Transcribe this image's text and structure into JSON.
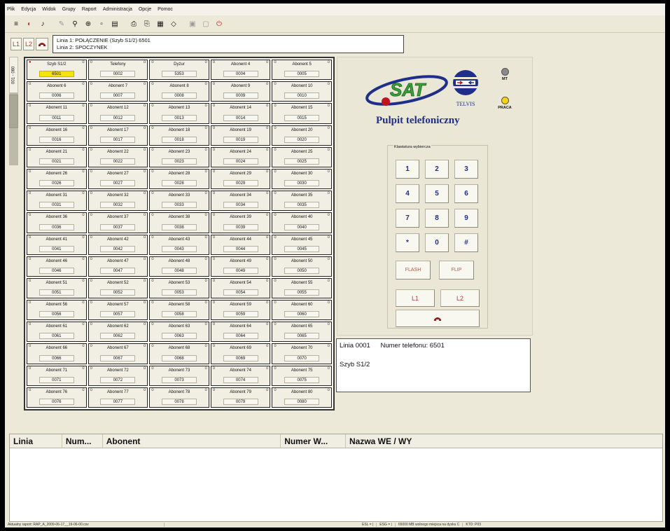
{
  "menu": [
    "Plik",
    "Edycja",
    "Widok",
    "Grupy",
    "Raport",
    "Administracja",
    "Opcje",
    "Pomoc"
  ],
  "toolbar": {
    "buttons": [
      {
        "icon": "list-icon",
        "glyph": "≡"
      },
      {
        "icon": "color-icon",
        "glyph": "◐"
      },
      {
        "icon": "sound-icon",
        "glyph": "♪"
      },
      {
        "icon": "edit-icon",
        "glyph": "✎"
      },
      {
        "icon": "binoculars-icon",
        "glyph": "⚲"
      },
      {
        "icon": "target-icon",
        "glyph": "⊕"
      },
      {
        "icon": "alarm-icon",
        "glyph": "▫"
      },
      {
        "icon": "document-icon",
        "glyph": "▤"
      },
      {
        "icon": "print-icon",
        "glyph": "⎙"
      },
      {
        "icon": "print-preview-icon",
        "glyph": "⎘"
      },
      {
        "icon": "calendar-icon",
        "glyph": "▦"
      },
      {
        "icon": "tag-icon",
        "glyph": "◇"
      },
      {
        "icon": "lock-icon",
        "glyph": "▣"
      },
      {
        "icon": "unlock-icon",
        "glyph": "▢"
      },
      {
        "icon": "power-icon",
        "glyph": "⏻"
      }
    ]
  },
  "linebar": {
    "l1": "L1",
    "l2": "L2",
    "line1": "Linia 1: POŁĄCZENIE (Szyb S1/2) 6501",
    "line2": "Linia 2: SPOCZYNEK"
  },
  "sidetab": "001 - 080",
  "subscribers": [
    {
      "name": "Szyb S1/2",
      "num": "6501",
      "active": true
    },
    {
      "name": "Telefony",
      "num": "0002"
    },
    {
      "name": "Dyżur",
      "num": "5353"
    },
    {
      "name": "Abonent 4",
      "num": "0004"
    },
    {
      "name": "Abonent 5",
      "num": "0005"
    },
    {
      "name": "Abonent 6",
      "num": "0006"
    },
    {
      "name": "Abonent 7",
      "num": "0007"
    },
    {
      "name": "Abonent 8",
      "num": "0008"
    },
    {
      "name": "Abonent 9",
      "num": "0009"
    },
    {
      "name": "Abonent 10",
      "num": "0010"
    },
    {
      "name": "Abonent 11",
      "num": "0011"
    },
    {
      "name": "Abonent 12",
      "num": "0012"
    },
    {
      "name": "Abonent 13",
      "num": "0013"
    },
    {
      "name": "Abonent 14",
      "num": "0014"
    },
    {
      "name": "Abonent 15",
      "num": "0015"
    },
    {
      "name": "Abonent 16",
      "num": "0016"
    },
    {
      "name": "Abonent 17",
      "num": "0017"
    },
    {
      "name": "Abonent 18",
      "num": "0018"
    },
    {
      "name": "Abonent 19",
      "num": "0019"
    },
    {
      "name": "Abonent 20",
      "num": "0020"
    },
    {
      "name": "Abonent 21",
      "num": "0021"
    },
    {
      "name": "Abonent 22",
      "num": "0022"
    },
    {
      "name": "Abonent 23",
      "num": "0023"
    },
    {
      "name": "Abonent 24",
      "num": "0024"
    },
    {
      "name": "Abonent 25",
      "num": "0025"
    },
    {
      "name": "Abonent 26",
      "num": "0026"
    },
    {
      "name": "Abonent 27",
      "num": "0027"
    },
    {
      "name": "Abonent 28",
      "num": "0028"
    },
    {
      "name": "Abonent 29",
      "num": "0029"
    },
    {
      "name": "Abonent 30",
      "num": "0030"
    },
    {
      "name": "Abonent 31",
      "num": "0031"
    },
    {
      "name": "Abonent 32",
      "num": "0032"
    },
    {
      "name": "Abonent 33",
      "num": "0033"
    },
    {
      "name": "Abonent 34",
      "num": "0034"
    },
    {
      "name": "Abonent 35",
      "num": "0035"
    },
    {
      "name": "Abonent 36",
      "num": "0036"
    },
    {
      "name": "Abonent 37",
      "num": "0037"
    },
    {
      "name": "Abonent 38",
      "num": "0038"
    },
    {
      "name": "Abonent 39",
      "num": "0039"
    },
    {
      "name": "Abonent 40",
      "num": "0040"
    },
    {
      "name": "Abonent 41",
      "num": "0041"
    },
    {
      "name": "Abonent 42",
      "num": "0042"
    },
    {
      "name": "Abonent 43",
      "num": "0043"
    },
    {
      "name": "Abonent 44",
      "num": "0044"
    },
    {
      "name": "Abonent 45",
      "num": "0045"
    },
    {
      "name": "Abonent 46",
      "num": "0046"
    },
    {
      "name": "Abonent 47",
      "num": "0047"
    },
    {
      "name": "Abonent 48",
      "num": "0048"
    },
    {
      "name": "Abonent 49",
      "num": "0049"
    },
    {
      "name": "Abonent 50",
      "num": "0050"
    },
    {
      "name": "Abonent 51",
      "num": "0051"
    },
    {
      "name": "Abonent 52",
      "num": "0052"
    },
    {
      "name": "Abonent 53",
      "num": "0053"
    },
    {
      "name": "Abonent 54",
      "num": "0054"
    },
    {
      "name": "Abonent 55",
      "num": "0055"
    },
    {
      "name": "Abonent 56",
      "num": "0056"
    },
    {
      "name": "Abonent 57",
      "num": "0057"
    },
    {
      "name": "Abonent 58",
      "num": "0058"
    },
    {
      "name": "Abonent 59",
      "num": "0059"
    },
    {
      "name": "Abonent 60",
      "num": "0060"
    },
    {
      "name": "Abonent 61",
      "num": "0061"
    },
    {
      "name": "Abonent 62",
      "num": "0062"
    },
    {
      "name": "Abonent 63",
      "num": "0063"
    },
    {
      "name": "Abonent 64",
      "num": "0064"
    },
    {
      "name": "Abonent 65",
      "num": "0065"
    },
    {
      "name": "Abonent 66",
      "num": "0066"
    },
    {
      "name": "Abonent 67",
      "num": "0067"
    },
    {
      "name": "Abonent 68",
      "num": "0068"
    },
    {
      "name": "Abonent 69",
      "num": "0069"
    },
    {
      "name": "Abonent 70",
      "num": "0070"
    },
    {
      "name": "Abonent 71",
      "num": "0071"
    },
    {
      "name": "Abonent 72",
      "num": "0072"
    },
    {
      "name": "Abonent 73",
      "num": "0073"
    },
    {
      "name": "Abonent 74",
      "num": "0074"
    },
    {
      "name": "Abonent 75",
      "num": "0075"
    },
    {
      "name": "Abonent 76",
      "num": "0076"
    },
    {
      "name": "Abonent 77",
      "num": "0077"
    },
    {
      "name": "Abonent 78",
      "num": "0078"
    },
    {
      "name": "Abonent 79",
      "num": "0079"
    },
    {
      "name": "Abonent 80",
      "num": "0080"
    }
  ],
  "panel": {
    "logo_text": "SAT",
    "telvis": "TELVIS",
    "title": "Pulpit telefoniczny",
    "indicators": [
      {
        "label": "MT",
        "color": "#8a8a8a"
      },
      {
        "label": "PRACA",
        "color": "#f5d40c"
      }
    ],
    "keypad_title": "Klawiatura wybiercza",
    "keys": [
      "1",
      "2",
      "3",
      "4",
      "5",
      "6",
      "7",
      "8",
      "9",
      "*",
      "0",
      "#"
    ],
    "flash": "FLASH",
    "flip": "FLIP",
    "l1": "L1",
    "l2": "L2"
  },
  "info": {
    "linia": "Linia 0001",
    "numer": "Numer telefonu: 6501",
    "szyb": "Szyb S1/2"
  },
  "table": {
    "columns": [
      "Linia",
      "Num...",
      "Abonent",
      "Numer W...",
      "Nazwa WE / WY"
    ]
  },
  "statusbar": {
    "left": "Aktualny raport: RAP_A_2009-06-17__19-06-00.csv",
    "s1": "ESL = |",
    "s2": "ESG = |",
    "s3": "65000 MB wolnego miejsca na dysku C",
    "s4": "KTD: P03"
  }
}
